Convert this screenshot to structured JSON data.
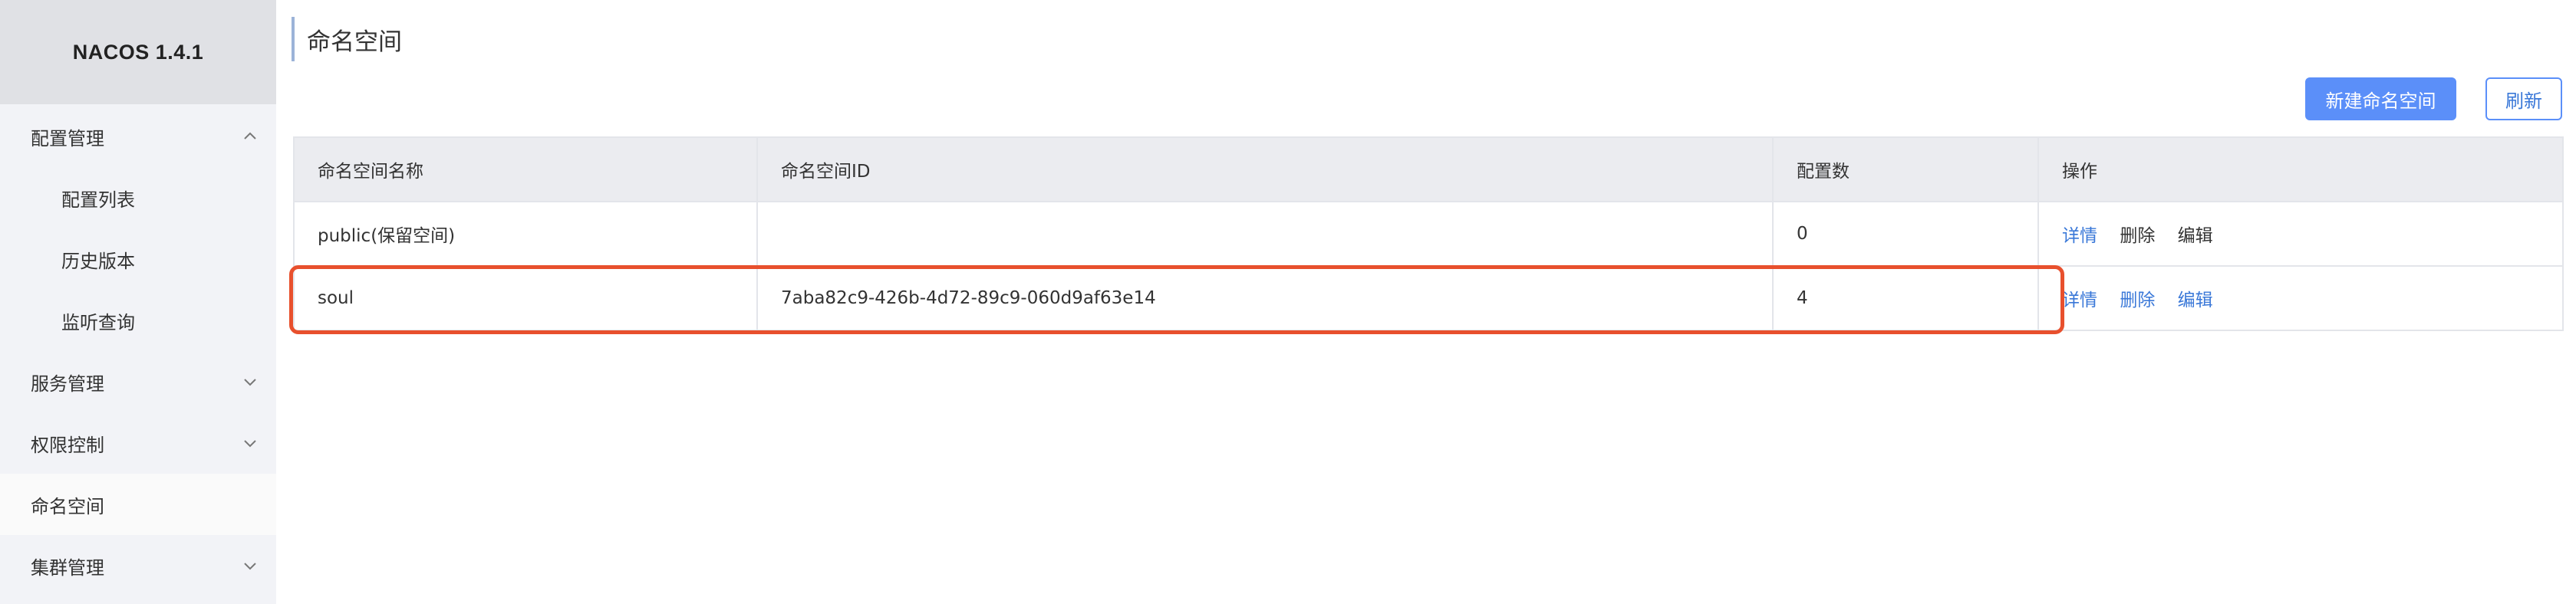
{
  "app": {
    "brand": "NACOS 1.4.1"
  },
  "sidebar": {
    "items": [
      {
        "label": "配置管理",
        "chevron": "up"
      },
      {
        "label": "配置列表"
      },
      {
        "label": "历史版本"
      },
      {
        "label": "监听查询"
      },
      {
        "label": "服务管理",
        "chevron": "down"
      },
      {
        "label": "权限控制",
        "chevron": "down"
      },
      {
        "label": "命名空间",
        "active": true
      },
      {
        "label": "集群管理",
        "chevron": "down"
      }
    ]
  },
  "main": {
    "title": "命名空间",
    "buttons": {
      "create": "新建命名空间",
      "refresh": "刷新"
    },
    "table": {
      "headers": [
        "命名空间名称",
        "命名空间ID",
        "配置数",
        "操作"
      ],
      "rows": [
        {
          "name": "public(保留空间)",
          "id": "",
          "count": "0",
          "actions": [
            "详情",
            "删除",
            "编辑"
          ]
        },
        {
          "name": "soul",
          "id": "7aba82c9-426b-4d72-89c9-060d9af63e14",
          "count": "4",
          "actions": [
            "详情",
            "删除",
            "编辑"
          ]
        }
      ]
    }
  },
  "colors": {
    "accent": "#5b8ff9",
    "link": "#3a78d8",
    "highlight": "#e8502d",
    "sidebar_bg": "#f2f3f7"
  }
}
